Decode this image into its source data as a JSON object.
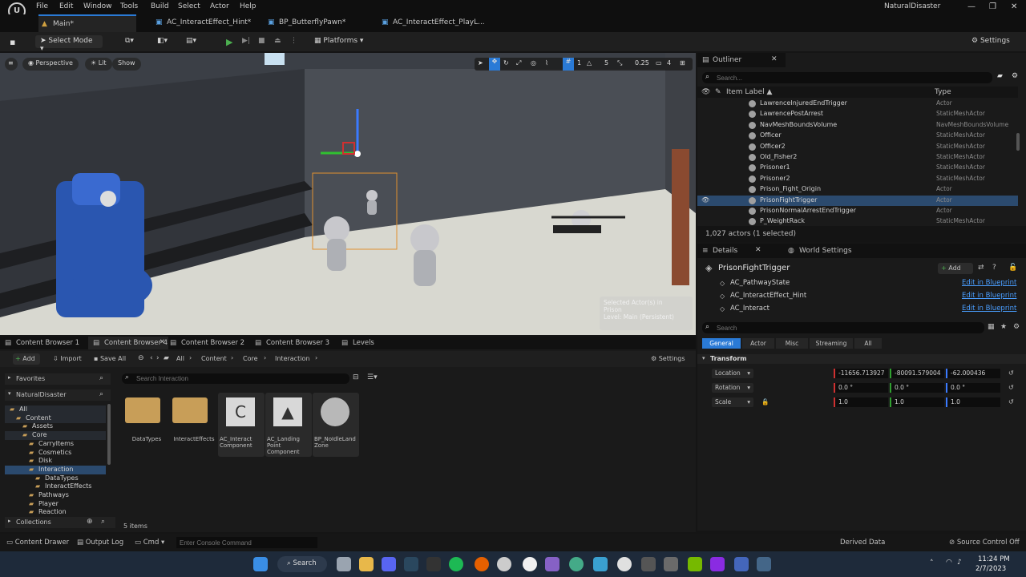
{
  "app": {
    "project_name": "NaturalDisaster",
    "window_controls": [
      "—",
      "❐",
      "✕"
    ]
  },
  "menu": [
    "File",
    "Edit",
    "Window",
    "Tools",
    "Build",
    "Select",
    "Actor",
    "Help"
  ],
  "tabs": [
    {
      "label": "Main*",
      "active": true
    },
    {
      "label": "AC_InteractEffect_Hint*",
      "active": false
    },
    {
      "label": "BP_ButterflyPawn*",
      "active": false
    },
    {
      "label": "AC_InteractEffect_PlayL...",
      "active": false
    }
  ],
  "toolbar": {
    "select_mode": "Select Mode",
    "platforms": "Platforms",
    "settings": "Settings"
  },
  "viewport": {
    "perspective": "Perspective",
    "lit": "Lit",
    "show": "Show",
    "snap_scale": "0.25",
    "grid_num": "1",
    "rot_num": "5",
    "cam_speed": "4",
    "tooltip_line1": "Selected Actor(s) in",
    "tooltip_line2": "Prison",
    "tooltip_line3": "Level: Main (Persistent)"
  },
  "outliner": {
    "title": "Outliner",
    "search_placeholder": "Search...",
    "col_label": "Item Label ▲",
    "col_type": "Type",
    "rows": [
      {
        "label": "LawrenceInjuredEndTrigger",
        "type": "Actor"
      },
      {
        "label": "LawrencePostArrest",
        "type": "StaticMeshActor"
      },
      {
        "label": "NavMeshBoundsVolume",
        "type": "NavMeshBoundsVolume"
      },
      {
        "label": "Officer",
        "type": "StaticMeshActor"
      },
      {
        "label": "Officer2",
        "type": "StaticMeshActor"
      },
      {
        "label": "Old_Fisher2",
        "type": "StaticMeshActor"
      },
      {
        "label": "Prisoner1",
        "type": "StaticMeshActor"
      },
      {
        "label": "Prisoner2",
        "type": "StaticMeshActor"
      },
      {
        "label": "Prison_Fight_Origin",
        "type": "Actor"
      },
      {
        "label": "PrisonFightTrigger",
        "type": "Actor",
        "selected": true
      },
      {
        "label": "PrisonNormalArrestEndTrigger",
        "type": "Actor"
      },
      {
        "label": "P_WeightRack",
        "type": "StaticMeshActor"
      }
    ],
    "footer": "1,027 actors (1 selected)"
  },
  "details": {
    "tab_details": "Details",
    "tab_world": "World Settings",
    "actor_name": "PrisonFightTrigger",
    "add_label": "Add",
    "components": [
      {
        "name": "AC_PathwayState",
        "link": "Edit in Blueprint"
      },
      {
        "name": "AC_InteractEffect_Hint",
        "link": "Edit in Blueprint"
      },
      {
        "name": "AC_Interact",
        "link": "Edit in Blueprint"
      }
    ],
    "search_placeholder": "Search",
    "filters": [
      "General",
      "Actor",
      "Misc",
      "Streaming",
      "All"
    ],
    "section": "Transform",
    "transform": [
      {
        "label": "Location",
        "x": "-11656.713927",
        "y": "-80091.579004",
        "z": "-62.000436"
      },
      {
        "label": "Rotation",
        "x": "0.0 °",
        "y": "0.0 °",
        "z": "0.0 °"
      },
      {
        "label": "Scale",
        "x": "1.0",
        "y": "1.0",
        "z": "1.0"
      }
    ]
  },
  "content_browser": {
    "tabs": [
      "Content Browser 1",
      "Content Browser 4",
      "Content Browser 2",
      "Content Browser 3",
      "Levels"
    ],
    "add": "Add",
    "import": "Import",
    "save_all": "Save All",
    "breadcrumb": [
      "All",
      "Content",
      "Core",
      "Interaction"
    ],
    "settings": "Settings",
    "favorites": "Favorites",
    "project": "NaturalDisaster",
    "collections": "Collections",
    "search_placeholder": "Search Interaction",
    "tree": [
      "All",
      "Content",
      "Assets",
      "Core",
      "CarryItems",
      "Cosmetics",
      "Disk",
      "Interaction",
      "DataTypes",
      "InteractEffects",
      "Pathways",
      "Player",
      "Reaction"
    ],
    "assets": [
      {
        "name": "DataTypes",
        "kind": "folder"
      },
      {
        "name": "InteractEffects",
        "kind": "folder"
      },
      {
        "name": "AC_Interact Component",
        "kind": "c"
      },
      {
        "name": "AC_Landing Point Component",
        "kind": "c2"
      },
      {
        "name": "BP_NoIdleLand Zone",
        "kind": "sphere"
      }
    ],
    "count": "5 items"
  },
  "status": {
    "content_drawer": "Content Drawer",
    "output_log": "Output Log",
    "cmd": "Cmd",
    "console_placeholder": "Enter Console Command",
    "derived_data": "Derived Data",
    "source_control": "Source Control Off"
  },
  "taskbar": {
    "search": "Search",
    "time": "11:24 PM",
    "date": "2/7/2023"
  }
}
